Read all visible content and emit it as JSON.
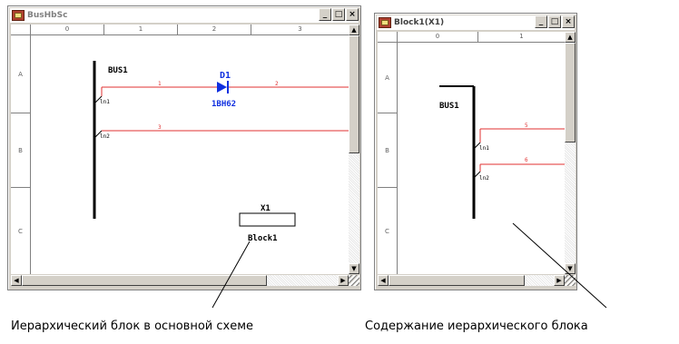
{
  "colors": {
    "wire": "#e03030",
    "component": "#1030e0",
    "bus": "#000000",
    "titlebar_text": "#808080"
  },
  "window1": {
    "title": "BusHbSc",
    "buttons": {
      "minimize": "_",
      "maximize": "□",
      "close": "×"
    },
    "ruler_cols": [
      "0",
      "1",
      "2",
      "3"
    ],
    "ruler_rows": [
      "A",
      "B",
      "C"
    ],
    "schematic": {
      "bus_label": "BUS1",
      "entry1": "ln1",
      "entry2": "ln2",
      "wire1": "1",
      "wire2": "2",
      "wire3": "3",
      "diode_ref": "D1",
      "diode_value": "1BH62",
      "block_ref": "X1",
      "block_name": "Block1"
    }
  },
  "window2": {
    "title": "Block1(X1)",
    "buttons": {
      "minimize": "_",
      "maximize": "□",
      "close": "×"
    },
    "ruler_cols": [
      "0",
      "1"
    ],
    "ruler_rows": [
      "A",
      "B",
      "C"
    ],
    "schematic": {
      "bus_label": "BUS1",
      "entry1": "ln1",
      "entry2": "ln2",
      "wire1": "5",
      "wire2": "6"
    }
  },
  "captions": {
    "left": "Иерархический блок в основной схеме",
    "right": "Содержание иерархического блока"
  }
}
